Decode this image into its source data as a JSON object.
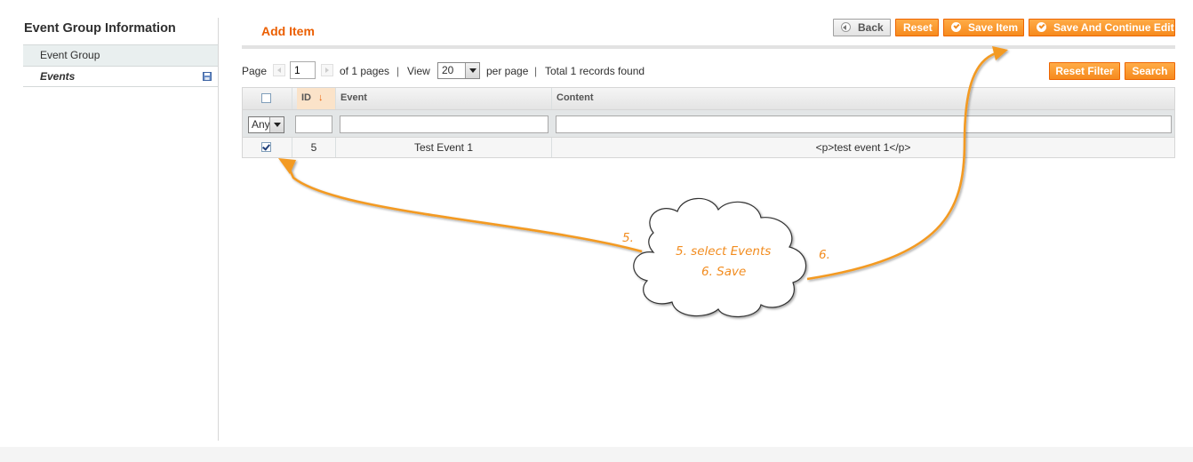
{
  "sidebar": {
    "title": "Event Group Information",
    "items": [
      {
        "label": "Event Group"
      },
      {
        "label": "Events"
      }
    ]
  },
  "header": {
    "title": "Add Item",
    "buttons": {
      "back": "Back",
      "reset": "Reset",
      "save_item": "Save Item",
      "save_continue": "Save And Continue Edit"
    }
  },
  "pager": {
    "page_label": "Page",
    "page_value": "1",
    "of_pages": "of 1 pages",
    "sep1": "|",
    "view_label": "View",
    "view_value": "20",
    "per_page": "per page",
    "sep2": "|",
    "total": "Total 1 records found"
  },
  "grid_actions": {
    "reset_filter": "Reset Filter",
    "search": "Search"
  },
  "grid": {
    "columns": [
      "ID",
      "Event",
      "Content"
    ],
    "filter_any": "Any",
    "rows": [
      {
        "checked": true,
        "id": "5",
        "event": "Test Event 1",
        "content": "<p>test event 1</p>"
      }
    ]
  },
  "annotation": {
    "cloud_line1": "5. select Events",
    "cloud_line2": "6. Save",
    "label_5": "5.",
    "label_6": "6.",
    "color": "#f28c1f"
  },
  "colors": {
    "accent": "#eb5e00",
    "button_orange": "#f68a1d"
  }
}
